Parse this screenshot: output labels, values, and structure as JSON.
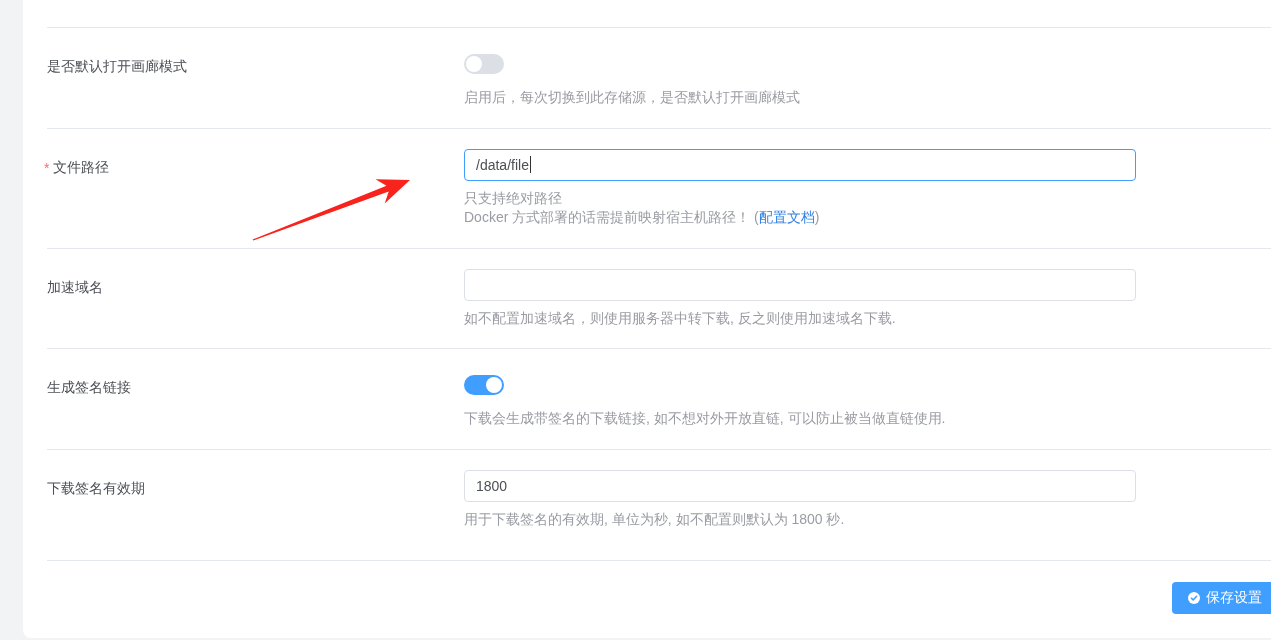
{
  "form": {
    "required_mark": "*",
    "fields": [
      {
        "kind": "switch",
        "label": "是否默认打开画廊模式",
        "required": false,
        "on": false,
        "hints": [
          {
            "text": "启用后，每次切换到此存储源，是否默认打开画廊模式"
          }
        ]
      },
      {
        "kind": "input",
        "label": "文件路径",
        "required": true,
        "value": "/data/file",
        "focused": true,
        "hints": [
          {
            "text": "只支持绝对路径"
          },
          {
            "text": "Docker 方式部署的话需提前映射宿主机路径！ (",
            "link": "配置文档",
            "tail": ")"
          }
        ]
      },
      {
        "kind": "input",
        "label": "加速域名",
        "required": false,
        "focused": false,
        "hints": [
          {
            "text": "如不配置加速域名，则使用服务器中转下载, 反之则使用加速域名下载."
          }
        ]
      },
      {
        "kind": "switch",
        "label": "生成签名链接",
        "required": false,
        "on": true,
        "hints": [
          {
            "text": "下载会生成带签名的下载链接, 如不想对外开放直链, 可以防止被当做直链使用."
          }
        ]
      },
      {
        "kind": "input",
        "label": "下载签名有效期",
        "required": false,
        "value": "1800",
        "focused": false,
        "hints": [
          {
            "text": "用于下载签名的有效期, 单位为秒, 如不配置则默认为 1800 秒."
          }
        ]
      }
    ]
  },
  "save_button": {
    "label": "保存设置"
  }
}
